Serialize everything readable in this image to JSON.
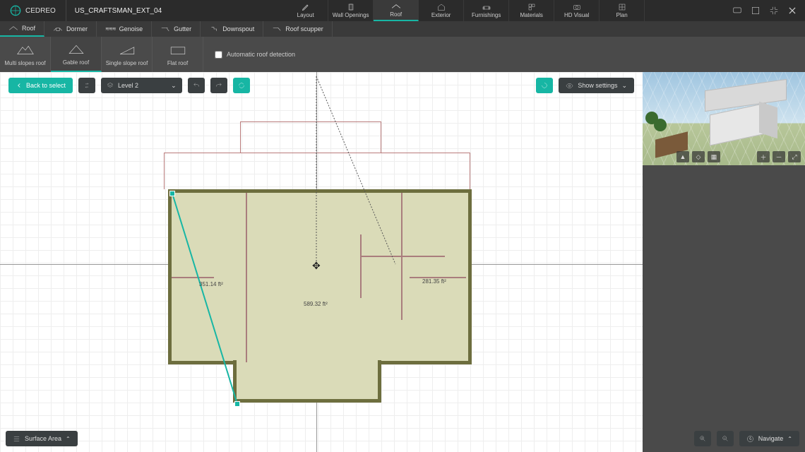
{
  "brand": {
    "name": "CEDREO"
  },
  "project": {
    "name": "US_CRAFTSMAN_EXT_04"
  },
  "mainTabs": [
    {
      "label": "Layout"
    },
    {
      "label": "Wall Openings"
    },
    {
      "label": "Roof"
    },
    {
      "label": "Exterior"
    },
    {
      "label": "Furnishings"
    },
    {
      "label": "Materials"
    },
    {
      "label": "HD Visual"
    },
    {
      "label": "Plan"
    }
  ],
  "subTabs": [
    {
      "label": "Roof"
    },
    {
      "label": "Dormer"
    },
    {
      "label": "Genoise"
    },
    {
      "label": "Gutter"
    },
    {
      "label": "Downspout"
    },
    {
      "label": "Roof scupper"
    }
  ],
  "roofTools": [
    {
      "label": "Multi slopes roof"
    },
    {
      "label": "Gable roof"
    },
    {
      "label": "Single slope roof"
    },
    {
      "label": "Flat roof"
    }
  ],
  "autoDetect": {
    "label": "Automatic roof detection"
  },
  "canvasBar": {
    "back": "Back to select",
    "level": "Level 2",
    "showSettings": "Show settings"
  },
  "rooms": {
    "left": "351.14 ft²",
    "center": "589.32 ft²",
    "right": "281.35 ft²"
  },
  "bottom": {
    "surfaceArea": "Surface Area",
    "navigate": "Navigate"
  }
}
